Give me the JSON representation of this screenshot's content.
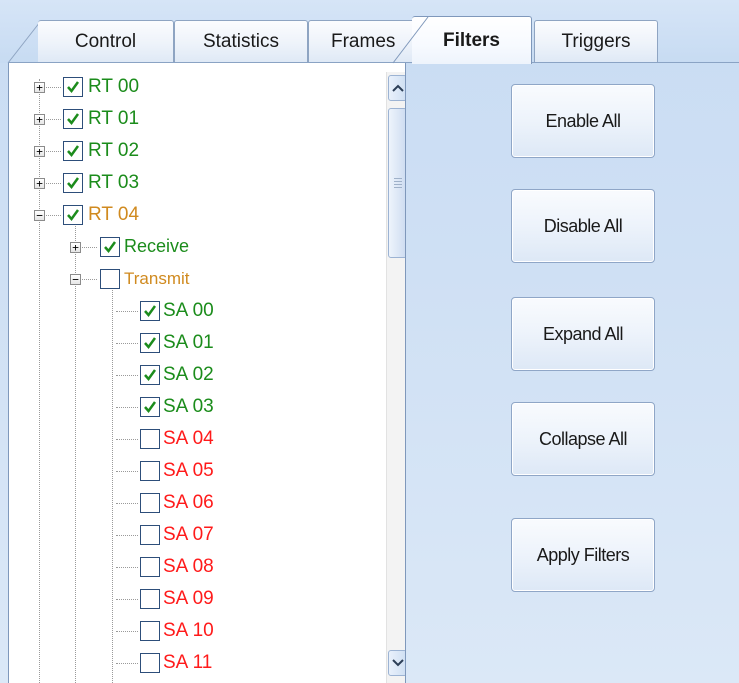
{
  "tabs": [
    {
      "label": "Control",
      "active": false
    },
    {
      "label": "Statistics",
      "active": false
    },
    {
      "label": "Frames",
      "active": false
    },
    {
      "label": "Filters",
      "active": true
    },
    {
      "label": "Triggers",
      "active": false
    }
  ],
  "tree": {
    "rt_nodes": [
      {
        "label": "RT 00",
        "checked": true,
        "expanded": false
      },
      {
        "label": "RT 01",
        "checked": true,
        "expanded": false
      },
      {
        "label": "RT 02",
        "checked": true,
        "expanded": false
      },
      {
        "label": "RT 03",
        "checked": true,
        "expanded": false
      },
      {
        "label": "RT 04",
        "checked": true,
        "expanded": true
      }
    ],
    "receive": {
      "label": "Receive",
      "checked": true,
      "expanded": false
    },
    "transmit": {
      "label": "Transmit",
      "checked": false,
      "expanded": true
    },
    "subaddresses": [
      {
        "label": "SA 00",
        "checked": true
      },
      {
        "label": "SA 01",
        "checked": true
      },
      {
        "label": "SA 02",
        "checked": true
      },
      {
        "label": "SA 03",
        "checked": true
      },
      {
        "label": "SA 04",
        "checked": false
      },
      {
        "label": "SA 05",
        "checked": false
      },
      {
        "label": "SA 06",
        "checked": false
      },
      {
        "label": "SA 07",
        "checked": false
      },
      {
        "label": "SA 08",
        "checked": false
      },
      {
        "label": "SA 09",
        "checked": false
      },
      {
        "label": "SA 10",
        "checked": false
      },
      {
        "label": "SA 11",
        "checked": false
      }
    ]
  },
  "colors": {
    "enabled": "#1b8c1b",
    "partial": "#d08a1f",
    "disabled": "#ff1a1a"
  },
  "buttons": {
    "enable_all": "Enable All",
    "disable_all": "Disable All",
    "expand_all": "Expand All",
    "collapse_all": "Collapse All",
    "apply_filters": "Apply Filters"
  },
  "icons": {
    "checkbox_checked": "checkmark-icon",
    "expander_collapsed": "plus-icon",
    "expander_expanded": "minus-icon",
    "scroll_up": "chevron-up-icon",
    "scroll_down": "chevron-down-icon"
  }
}
